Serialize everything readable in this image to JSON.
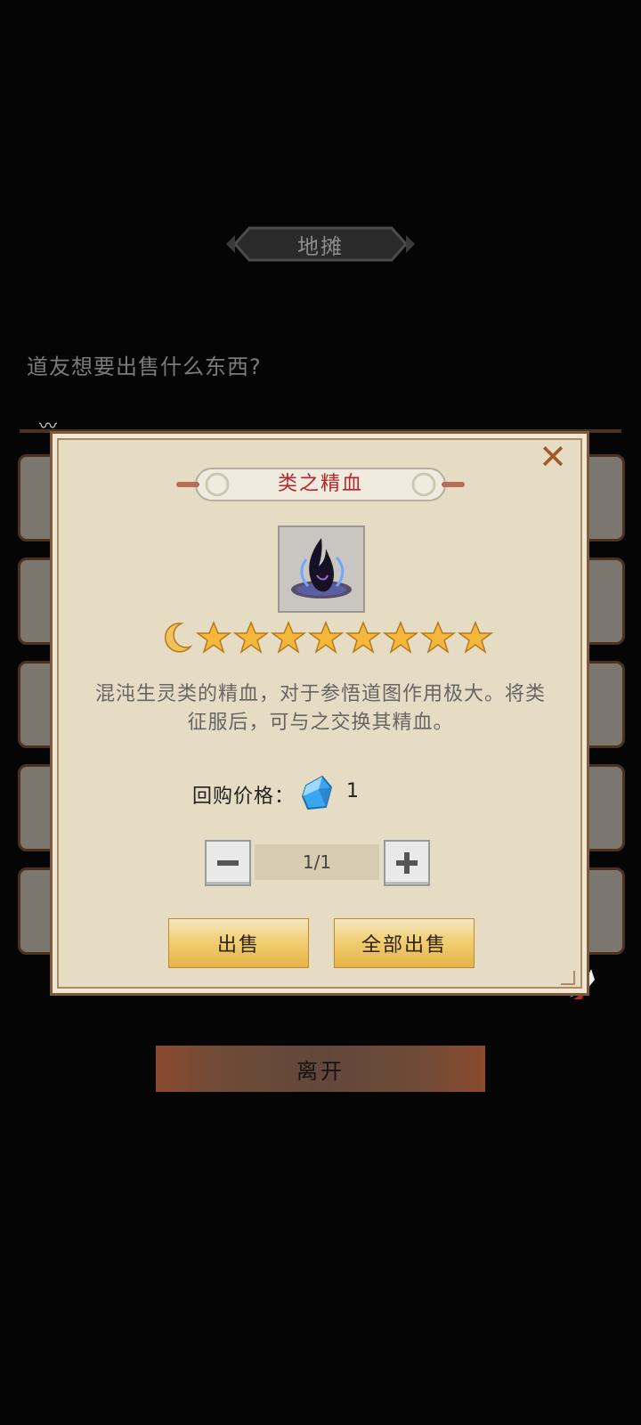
{
  "header": {
    "title": "地摊"
  },
  "prompt": "道友想要出售什么东西?",
  "dialog": {
    "item_name": "类之精血",
    "rating": {
      "moons": 1,
      "stars": 8
    },
    "description": "混沌生灵类的精血，对于参悟道图作用极大。将类征服后，可与之交换其精血。",
    "buyback_label": "回购价格：",
    "buyback_value": "1",
    "quantity": "1/1",
    "sell_label": "出售",
    "sell_all_label": "全部出售"
  },
  "footer": {
    "leave_label": "离开"
  },
  "icons": {
    "close": "close-icon",
    "item": "black-flame-icon",
    "price": "blue-crystal-icon",
    "minus": "minus-icon",
    "plus": "plus-icon"
  },
  "colors": {
    "accent_red": "#b7262a",
    "gold": "#f1cf73",
    "dialog_bg": "#e6dcc4"
  }
}
